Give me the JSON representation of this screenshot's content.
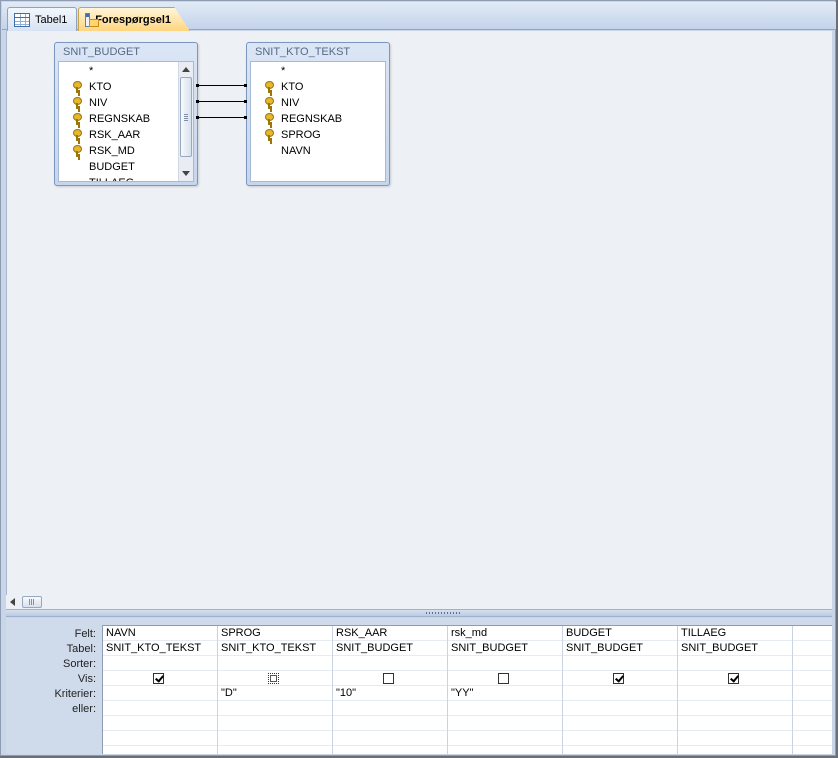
{
  "tabs": [
    {
      "label": "Tabel1",
      "icon": "table-icon"
    },
    {
      "label": "Forespørgsel1",
      "icon": "query-icon",
      "active": true
    }
  ],
  "field_lists": [
    {
      "title": "SNIT_BUDGET",
      "fields": [
        {
          "name": "*",
          "key": false
        },
        {
          "name": "KTO",
          "key": true
        },
        {
          "name": "NIV",
          "key": true
        },
        {
          "name": "REGNSKAB",
          "key": true
        },
        {
          "name": "RSK_AAR",
          "key": true
        },
        {
          "name": "RSK_MD",
          "key": true
        },
        {
          "name": "BUDGET",
          "key": false
        },
        {
          "name": "TILLAEG",
          "key": false
        }
      ]
    },
    {
      "title": "SNIT_KTO_TEKST",
      "fields": [
        {
          "name": "*",
          "key": false
        },
        {
          "name": "KTO",
          "key": true
        },
        {
          "name": "NIV",
          "key": true
        },
        {
          "name": "REGNSKAB",
          "key": true
        },
        {
          "name": "SPROG",
          "key": true
        },
        {
          "name": "NAVN",
          "key": false
        }
      ]
    }
  ],
  "grid": {
    "row_labels": {
      "felt": "Felt:",
      "tabel": "Tabel:",
      "sorter": "Sorter:",
      "vis": "Vis:",
      "kriterier": "Kriterier:",
      "eller": "eller:"
    },
    "columns": [
      {
        "felt": "NAVN",
        "tabel": "SNIT_KTO_TEKST",
        "sorter": "",
        "vis": true,
        "kriterier": "",
        "eller": ""
      },
      {
        "felt": "SPROG",
        "tabel": "SNIT_KTO_TEKST",
        "sorter": "",
        "vis": false,
        "focused": true,
        "kriterier": "\"D\"",
        "eller": ""
      },
      {
        "felt": "RSK_AAR",
        "tabel": "SNIT_BUDGET",
        "sorter": "",
        "vis": false,
        "kriterier": "\"10\"",
        "eller": ""
      },
      {
        "felt": "rsk_md",
        "tabel": "SNIT_BUDGET",
        "sorter": "",
        "vis": false,
        "kriterier": "\"YY\"",
        "eller": ""
      },
      {
        "felt": "BUDGET",
        "tabel": "SNIT_BUDGET",
        "sorter": "",
        "vis": true,
        "kriterier": "",
        "eller": ""
      },
      {
        "felt": "TILLAEG",
        "tabel": "SNIT_BUDGET",
        "sorter": "",
        "vis": true,
        "kriterier": "",
        "eller": ""
      },
      {
        "felt": "",
        "tabel": "",
        "sorter": "",
        "vis": null,
        "kriterier": "",
        "eller": ""
      }
    ]
  }
}
